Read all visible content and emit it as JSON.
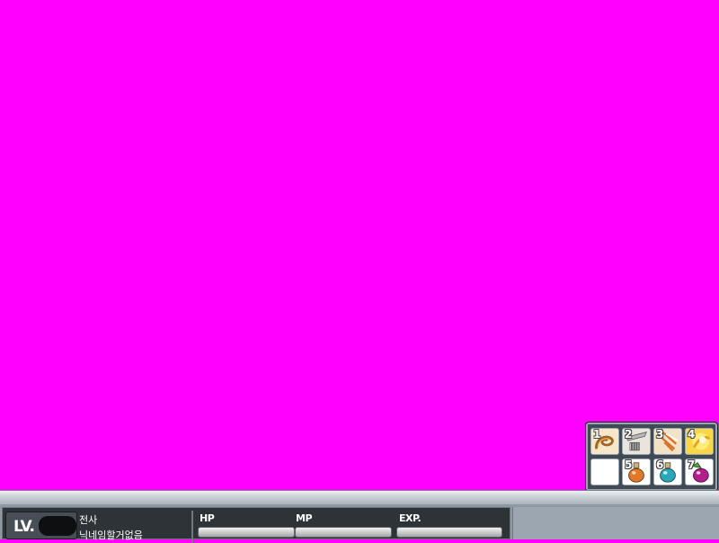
{
  "quickslot": {
    "slots": [
      {
        "key": "1",
        "icon": "skill-swirl-icon"
      },
      {
        "key": "2",
        "icon": "skill-weapon-icon"
      },
      {
        "key": "3",
        "icon": "skill-slash-icon"
      },
      {
        "key": "4",
        "icon": "skill-yellow-orb-icon"
      },
      {
        "key": "",
        "icon": "empty-slot"
      },
      {
        "key": "5",
        "icon": "orange-potion-icon"
      },
      {
        "key": "6",
        "icon": "blue-potion-icon"
      },
      {
        "key": "7",
        "icon": "purple-potion-icon"
      }
    ]
  },
  "status": {
    "level_label": "LV.",
    "level_value": "",
    "job": "전사",
    "name": "닉네임할거없음",
    "hp_label": "HP",
    "mp_label": "MP",
    "exp_label": "EXP.",
    "hp_fill": 0,
    "mp_fill": 0,
    "exp_fill": 0
  },
  "colors": {
    "background": "#ff00ff",
    "hp": "#e84c4c",
    "mp": "#3b6fe0",
    "exp": "#e8d93b"
  }
}
